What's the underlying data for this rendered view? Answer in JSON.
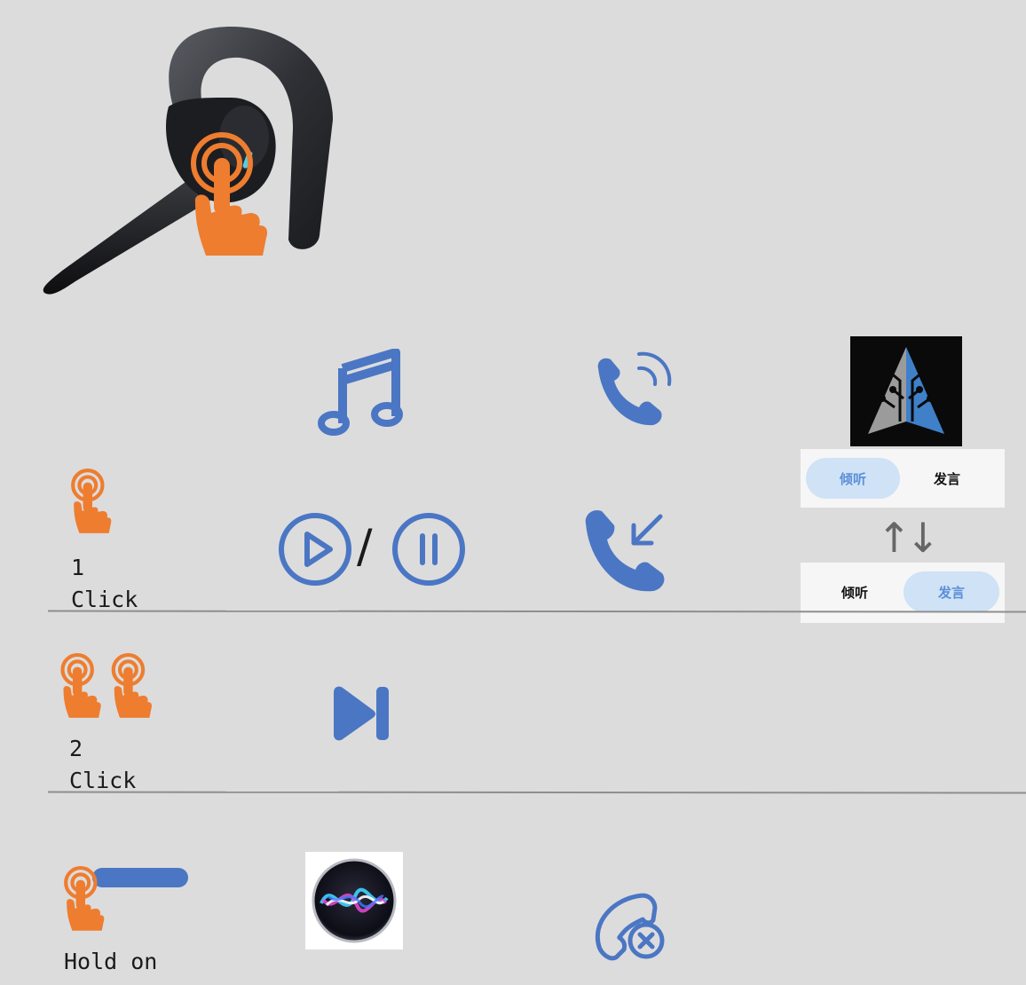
{
  "colors": {
    "background": "#dcdcdd",
    "icon_blue": "#4b76c3",
    "hand_orange": "#ee7d2f",
    "divider": "#8e8e8e"
  },
  "rows": [
    {
      "count": "1",
      "action": "Click"
    },
    {
      "count": "2",
      "action": "Click"
    },
    {
      "action": "Hold on"
    }
  ],
  "icons": {
    "row1": [
      "music-note-icon",
      "incoming-call-icon",
      "app-logo-icon",
      "play-icon",
      "pause-icon",
      "answer-call-icon"
    ],
    "row2": [
      "next-track-icon"
    ],
    "row3": [
      "siri-icon",
      "reject-call-icon"
    ]
  },
  "play_pause_separator": "/",
  "toggle": {
    "listen": "倾听",
    "speak": "发言",
    "swap_arrows": "↑↓"
  }
}
